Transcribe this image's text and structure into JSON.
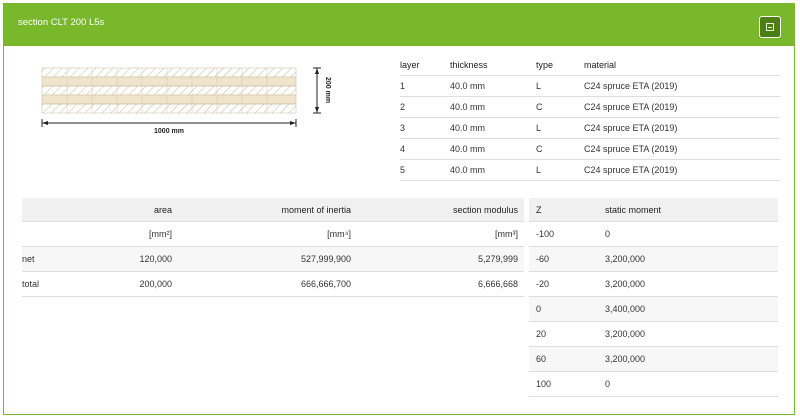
{
  "header": {
    "title": "section CLT 200 L5s"
  },
  "diagram": {
    "width_label": "1000 mm",
    "height_label": "200 mm",
    "layer_pattern": [
      "L",
      "C",
      "L",
      "C",
      "L"
    ]
  },
  "layers_table": {
    "headers": [
      "layer",
      "thickness",
      "type",
      "material"
    ],
    "rows": [
      [
        "1",
        "40.0 mm",
        "L",
        "C24 spruce ETA (2019)"
      ],
      [
        "2",
        "40.0 mm",
        "C",
        "C24 spruce ETA (2019)"
      ],
      [
        "3",
        "40.0 mm",
        "L",
        "C24 spruce ETA (2019)"
      ],
      [
        "4",
        "40.0 mm",
        "C",
        "C24 spruce ETA (2019)"
      ],
      [
        "5",
        "40.0 mm",
        "L",
        "C24 spruce ETA (2019)"
      ]
    ]
  },
  "properties_table": {
    "headers": [
      "",
      "area",
      "moment of inertia",
      "section modulus"
    ],
    "units": [
      "",
      "[mm²]",
      "[mm⁴]",
      "[mm³]"
    ],
    "rows": [
      [
        "net",
        "120,000",
        "527,999,900",
        "5,279,999"
      ],
      [
        "total",
        "200,000",
        "666,666,700",
        "6,666,668"
      ]
    ]
  },
  "static_table": {
    "headers": [
      "Z",
      "static moment"
    ],
    "rows": [
      [
        "-100",
        "0"
      ],
      [
        "-60",
        "3,200,000"
      ],
      [
        "-20",
        "3,200,000"
      ],
      [
        "0",
        "3,400,000"
      ],
      [
        "20",
        "3,200,000"
      ],
      [
        "60",
        "3,200,000"
      ],
      [
        "100",
        "0"
      ]
    ]
  }
}
